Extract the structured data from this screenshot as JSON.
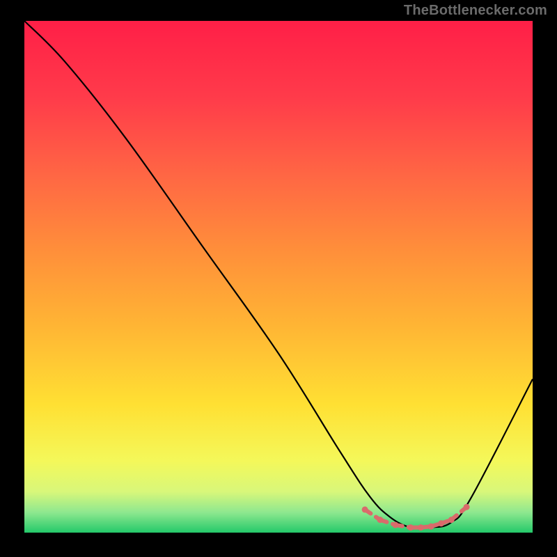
{
  "watermark": "TheBottlenecker.com",
  "chart_data": {
    "type": "line",
    "title": "",
    "xlabel": "",
    "ylabel": "",
    "xlim": [
      0,
      100
    ],
    "ylim": [
      0,
      100
    ],
    "grid": false,
    "series": [
      {
        "name": "curve",
        "color": "#000000",
        "x": [
          0,
          8,
          20,
          35,
          50,
          62,
          68,
          72,
          76,
          80,
          84,
          88,
          100
        ],
        "y": [
          100,
          92,
          77,
          56,
          35,
          16,
          7,
          3,
          1,
          1,
          2,
          7,
          30
        ]
      }
    ],
    "highlight": {
      "name": "bottom-highlight",
      "color": "#d96b6b",
      "x": [
        67,
        70,
        73,
        76,
        78,
        80,
        82,
        84,
        87
      ],
      "y": [
        4.5,
        2.5,
        1.5,
        1.0,
        1.0,
        1.2,
        1.8,
        2.5,
        5.0
      ]
    },
    "background": {
      "description": "vertical gradient behind plot area, top to bottom",
      "stops": [
        {
          "offset": 0.0,
          "color": "#ff1f47"
        },
        {
          "offset": 0.15,
          "color": "#ff3b4a"
        },
        {
          "offset": 0.3,
          "color": "#ff6644"
        },
        {
          "offset": 0.45,
          "color": "#ff8f3a"
        },
        {
          "offset": 0.6,
          "color": "#ffb634"
        },
        {
          "offset": 0.75,
          "color": "#ffe033"
        },
        {
          "offset": 0.86,
          "color": "#f4f85a"
        },
        {
          "offset": 0.92,
          "color": "#d8f77a"
        },
        {
          "offset": 0.96,
          "color": "#8fe88f"
        },
        {
          "offset": 1.0,
          "color": "#24c96a"
        }
      ]
    }
  }
}
